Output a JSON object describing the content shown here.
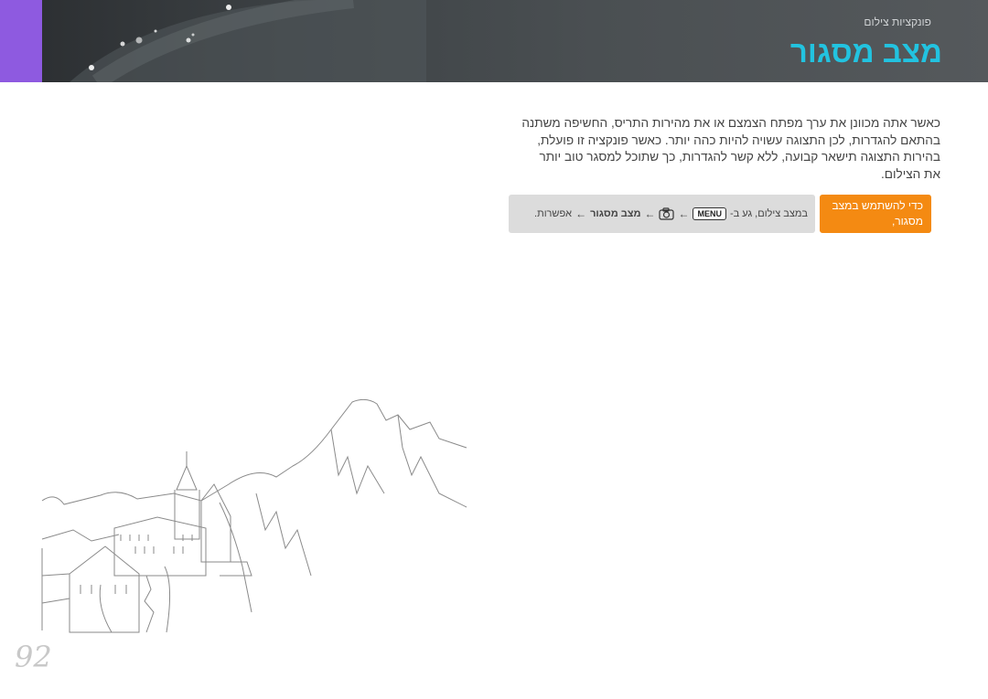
{
  "header": {
    "breadcrumb": "פונקציות צילום",
    "title": "מצב מסגור",
    "accent_color": "#8e5ae0",
    "title_color": "#22c3e0"
  },
  "body": {
    "line1": "כאשר אתה מכוונן את ערך מפתח הצמצם או את מהירות התריס, החשיפה משתנה",
    "line2": "בהתאם להגדרות, לכן התצוגה עשויה להיות כהה יותר. כאשר פונקציה זו פועלת,",
    "line3": "בהירות התצוגה תישאר קבועה, ללא קשר להגדרות, כך שתוכל למסגר טוב יותר",
    "line4": "את הצילום."
  },
  "howto": {
    "label_line1": "כדי להשתמש במצב",
    "label_line2": "מסגור,",
    "path_prefix": "במצב צילום, גע ב-",
    "menu_key": "MENU",
    "arrow1": "←",
    "camera_icon": "camera-icon",
    "arrow2": "←",
    "frame_mode": "מצב מסגור",
    "arrow3": "←",
    "option": "אפשרות.",
    "label_color": "#f48a12"
  },
  "page_number": "92"
}
